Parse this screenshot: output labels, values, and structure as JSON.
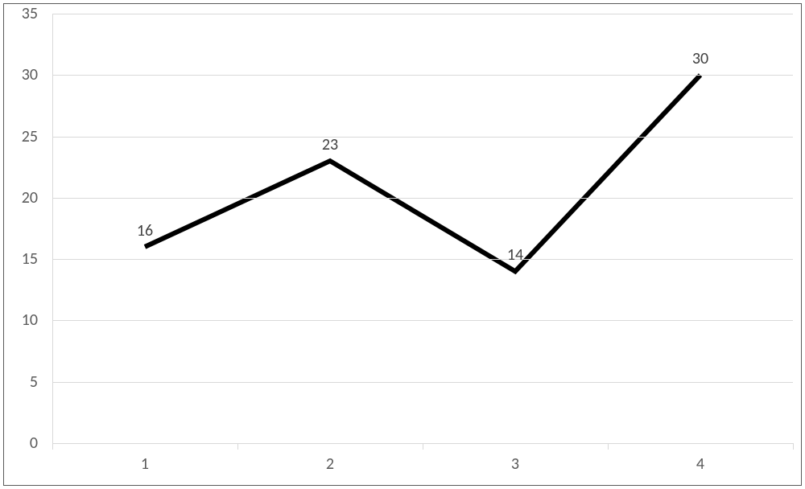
{
  "chart_data": {
    "type": "line",
    "categories": [
      "1",
      "2",
      "3",
      "4"
    ],
    "values": [
      16,
      23,
      14,
      30
    ],
    "title": "",
    "xlabel": "",
    "ylabel": "",
    "ylim": [
      0,
      35
    ],
    "ystep": 5,
    "yticks": [
      "0",
      "5",
      "10",
      "15",
      "20",
      "25",
      "30",
      "35"
    ],
    "show_data_labels": true,
    "line_color": "#000000",
    "grid_color": "#d9d9d9"
  }
}
